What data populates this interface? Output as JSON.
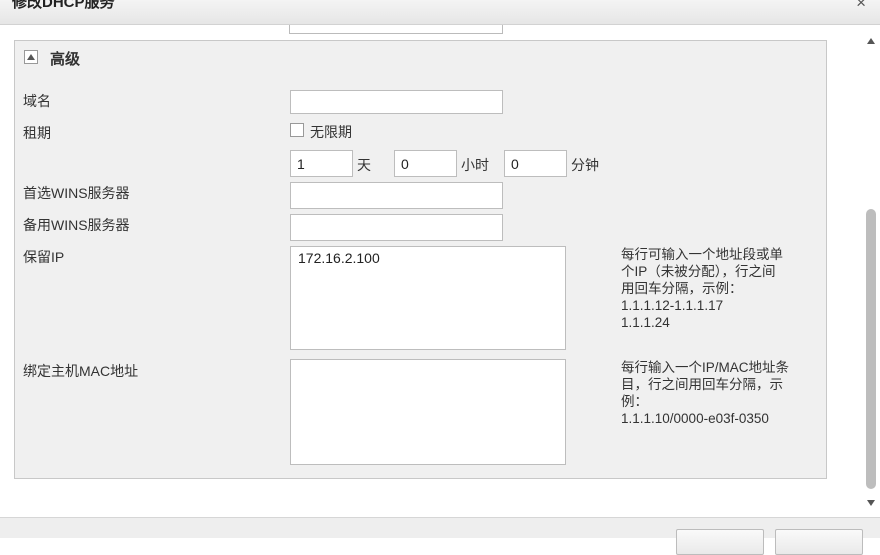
{
  "window": {
    "title": "修改DHCP服务",
    "close_glyph": "×"
  },
  "section": {
    "title": "高级",
    "toggle_icon": "collapse-up-triangle"
  },
  "fields": {
    "domain_name": {
      "label": "域名",
      "value": ""
    },
    "lease": {
      "label": "租期",
      "unlimited_label": "无限期",
      "unlimited_checked": false,
      "days_value": "1",
      "days_unit": "天",
      "hours_value": "0",
      "hours_unit": "小时",
      "minutes_value": "0",
      "minutes_unit": "分钟"
    },
    "primary_wins": {
      "label": "首选WINS服务器",
      "value": ""
    },
    "backup_wins": {
      "label": "备用WINS服务器",
      "value": ""
    },
    "reserved_ip": {
      "label": "保留IP",
      "value": "172.16.2.100",
      "hint_lines": [
        "每行可输入一个地址段或单",
        "个IP（未被分配），行之间",
        "用回车分隔，示例：",
        "1.1.1.12-1.1.1.17",
        "1.1.1.24"
      ]
    },
    "bind_mac": {
      "label": "绑定主机MAC地址",
      "value": "",
      "hint_lines": [
        "每行输入一个IP/MAC地址条",
        "目，行之间用回车分隔，示",
        "例：",
        "1.1.1.10/0000-e03f-0350"
      ]
    }
  },
  "colors": {
    "panel_bg": "#f0f0f0",
    "border": "#c8c8c8",
    "scroll_thumb": "#bdbdbd"
  }
}
